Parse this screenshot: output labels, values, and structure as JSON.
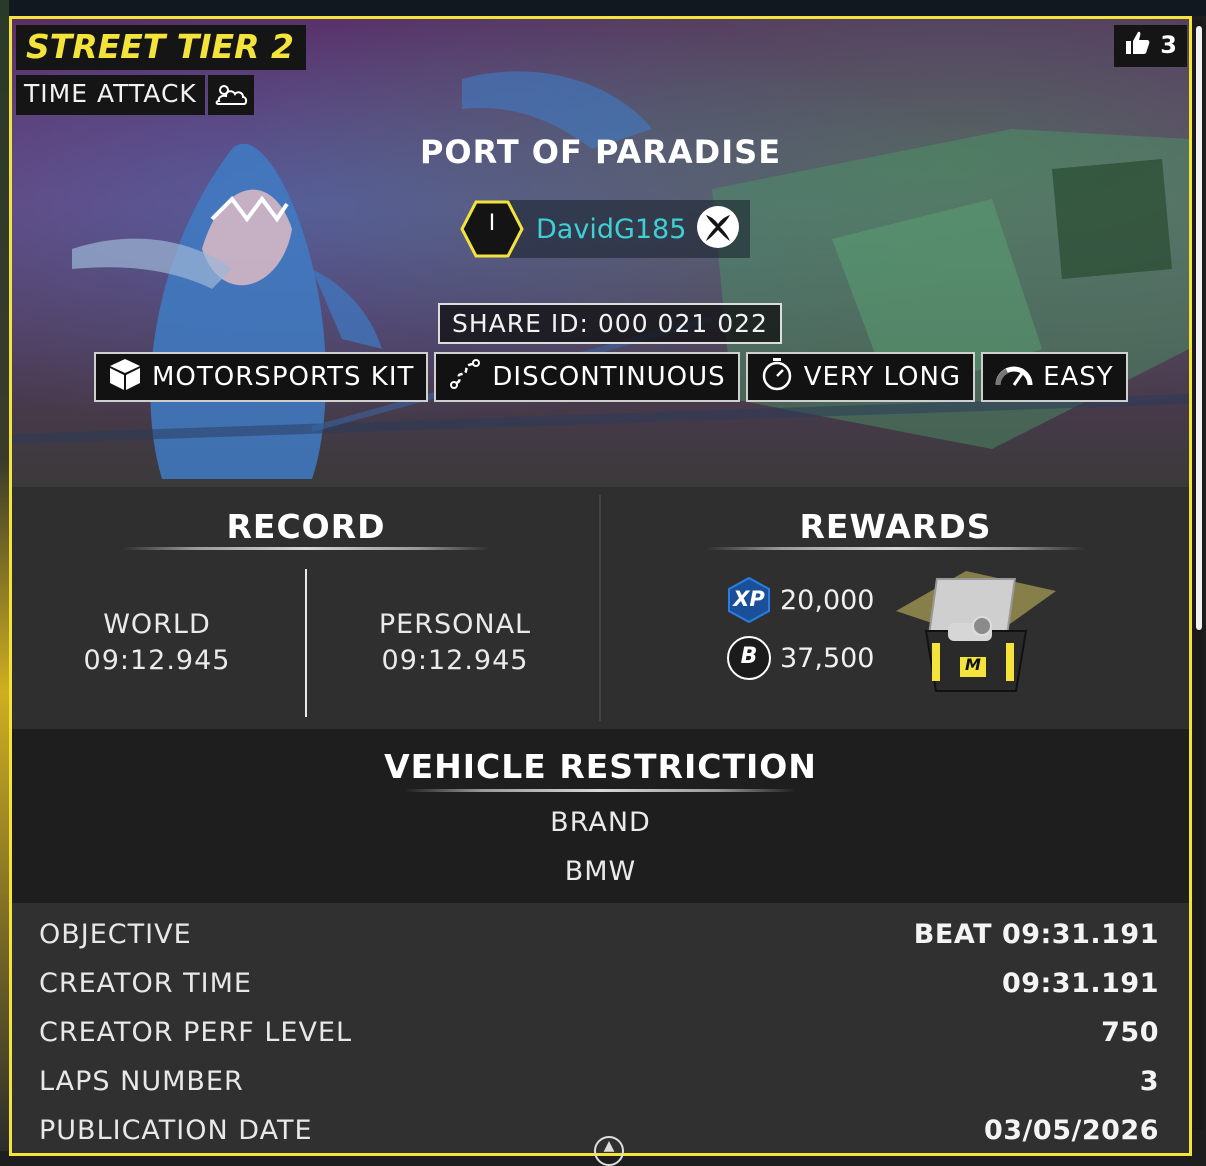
{
  "event": {
    "tier": "STREET TIER 2",
    "mode": "TIME ATTACK",
    "weather_icon": "cloud-sun-icon",
    "likes": "3"
  },
  "track": {
    "title": "PORT OF PARADISE",
    "creator_level": "I",
    "creator_name": "DavidG185",
    "platform_icon": "xbox-icon",
    "share_id": "SHARE ID: 000 021 022"
  },
  "tags": [
    {
      "label": "MOTORSPORTS KIT",
      "icon": "cube-icon"
    },
    {
      "label": "DISCONTINUOUS",
      "icon": "route-icon"
    },
    {
      "label": "VERY LONG",
      "icon": "stopwatch-icon"
    },
    {
      "label": "EASY",
      "icon": "speedometer-icon"
    }
  ],
  "record": {
    "title": "RECORD",
    "world_label": "WORLD",
    "world_time": "09:12.945",
    "personal_label": "PERSONAL",
    "personal_time": "09:12.945"
  },
  "rewards": {
    "title": "REWARDS",
    "xp_badge": "XP",
    "xp": "20,000",
    "currency_symbol": "B",
    "bucks": "37,500",
    "crate_letter": "M"
  },
  "restriction": {
    "title": "VEHICLE RESTRICTION",
    "type": "BRAND",
    "value": "BMW"
  },
  "details": [
    {
      "label": "OBJECTIVE",
      "value": "BEAT 09:31.191"
    },
    {
      "label": "CREATOR TIME",
      "value": "09:31.191"
    },
    {
      "label": "CREATOR PERF LEVEL",
      "value": "750"
    },
    {
      "label": "LAPS NUMBER",
      "value": "3"
    },
    {
      "label": "PUBLICATION DATE",
      "value": "03/05/2026"
    }
  ],
  "colors": {
    "accent_yellow": "#f3e33b",
    "creator_cyan": "#3fd0d4",
    "xp_blue": "#2a7de1"
  }
}
